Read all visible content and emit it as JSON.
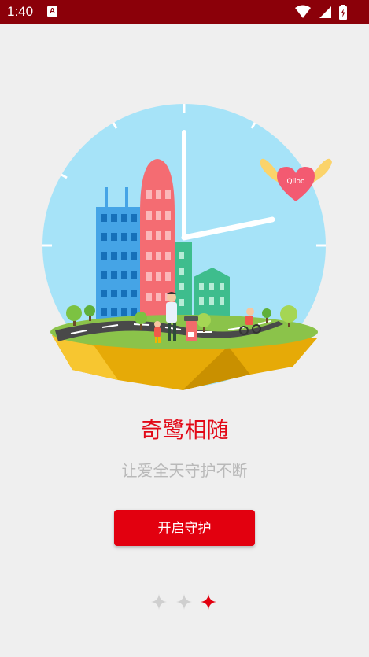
{
  "status_bar": {
    "time": "1:40",
    "badge": "A",
    "icons": [
      "wifi-icon",
      "signal-icon",
      "battery-icon"
    ]
  },
  "illustration": {
    "badge_text": "Qiloo"
  },
  "onboarding": {
    "title": "奇鹭相随",
    "subtitle": "让爱全天守护不断",
    "button_label": "开启守护"
  },
  "pager": {
    "total": 3,
    "active_index": 2
  },
  "colors": {
    "status_bar": "#8b0009",
    "accent": "#e2000f",
    "background": "#efefef",
    "inactive_dot": "#cfcfcf"
  }
}
